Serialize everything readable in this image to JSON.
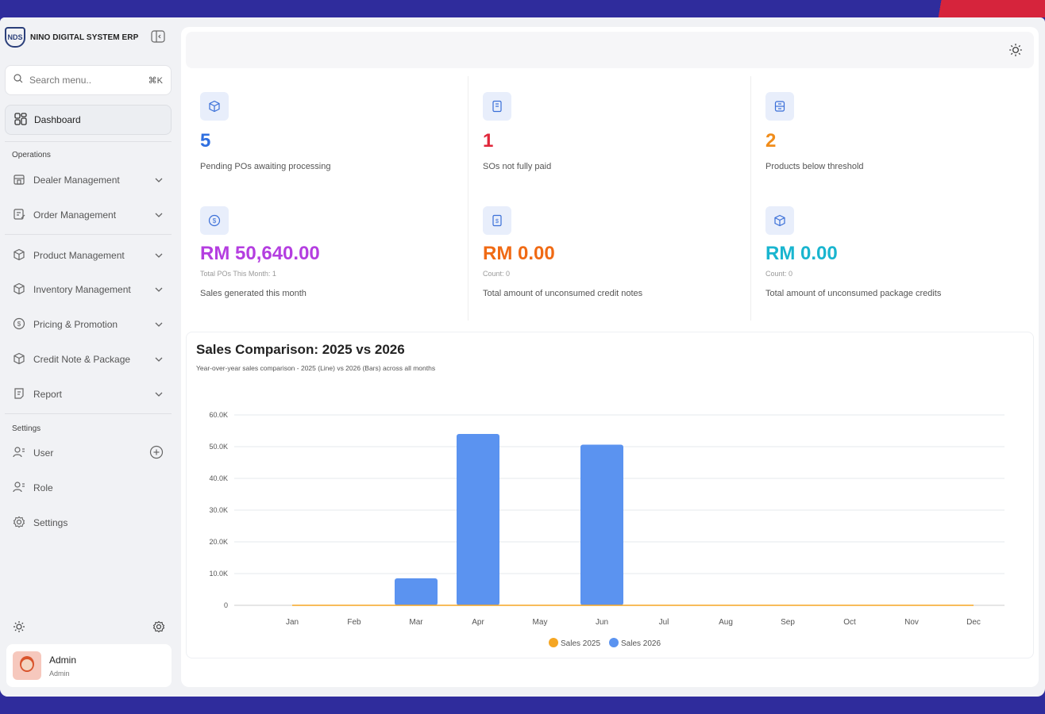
{
  "brand": {
    "logo_text": "NDS",
    "name": "NINO DIGITAL SYSTEM ERP"
  },
  "search": {
    "placeholder": "Search menu..",
    "shortcut": "⌘K"
  },
  "nav": {
    "dashboard": "Dashboard",
    "operations_title": "Operations",
    "operations": [
      {
        "label": "Dealer Management",
        "icon": "store-icon"
      },
      {
        "label": "Order Management",
        "icon": "order-icon"
      },
      {
        "label": "Product Management",
        "icon": "box-icon"
      },
      {
        "label": "Inventory Management",
        "icon": "box-icon"
      },
      {
        "label": "Pricing & Promotion",
        "icon": "dollar-circle-icon"
      },
      {
        "label": "Credit Note & Package",
        "icon": "box-icon"
      },
      {
        "label": "Report",
        "icon": "report-icon"
      }
    ],
    "settings_title": "Settings",
    "settings": [
      {
        "label": "User",
        "icon": "user-icon"
      },
      {
        "label": "Role",
        "icon": "user-icon"
      },
      {
        "label": "Settings",
        "icon": "gear-icon"
      }
    ]
  },
  "user": {
    "name": "Admin",
    "role": "Admin"
  },
  "stats_top": [
    {
      "value": "5",
      "color": "#2f6fe0",
      "desc": "Pending POs awaiting processing",
      "icon": "box-icon"
    },
    {
      "value": "1",
      "color": "#e0263a",
      "desc": "SOs not fully paid",
      "icon": "receipt-icon"
    },
    {
      "value": "2",
      "color": "#f08c1a",
      "desc": "Products below threshold",
      "icon": "server-icon"
    }
  ],
  "stats_bottom": [
    {
      "amount": "RM 50,640.00",
      "color": "#b43ee0",
      "sub": "Total POs This Month: 1",
      "desc": "Sales generated this month",
      "icon": "dollar-circle-icon"
    },
    {
      "amount": "RM 0.00",
      "color": "#f06a14",
      "sub": "Count: 0",
      "desc": "Total amount of unconsumed credit notes",
      "icon": "dollar-doc-icon"
    },
    {
      "amount": "RM 0.00",
      "color": "#19b5cf",
      "sub": "Count: 0",
      "desc": "Total amount of unconsumed package credits",
      "icon": "box-icon"
    }
  ],
  "chart": {
    "title": "Sales Comparison: 2025 vs 2026",
    "subtitle": "Year-over-year sales comparison - 2025 (Line) vs 2026 (Bars) across all months"
  },
  "chart_data": {
    "type": "bar",
    "categories": [
      "Jan",
      "Feb",
      "Mar",
      "Apr",
      "May",
      "Jun",
      "Jul",
      "Aug",
      "Sep",
      "Oct",
      "Nov",
      "Dec"
    ],
    "series": [
      {
        "name": "Sales 2025",
        "type": "line",
        "color": "#f5a623",
        "values": [
          0,
          0,
          0,
          0,
          0,
          0,
          0,
          0,
          0,
          0,
          0,
          0
        ]
      },
      {
        "name": "Sales 2026",
        "type": "bar",
        "color": "#5b93f0",
        "values": [
          0,
          0,
          8500,
          54000,
          0,
          50640,
          0,
          0,
          0,
          0,
          0,
          0
        ]
      }
    ],
    "yticks": [
      "0",
      "10.0K",
      "20.0K",
      "30.0K",
      "40.0K",
      "50.0K",
      "60.0K"
    ],
    "ylim": [
      0,
      60000
    ],
    "grid": true,
    "legend": "bottom"
  }
}
